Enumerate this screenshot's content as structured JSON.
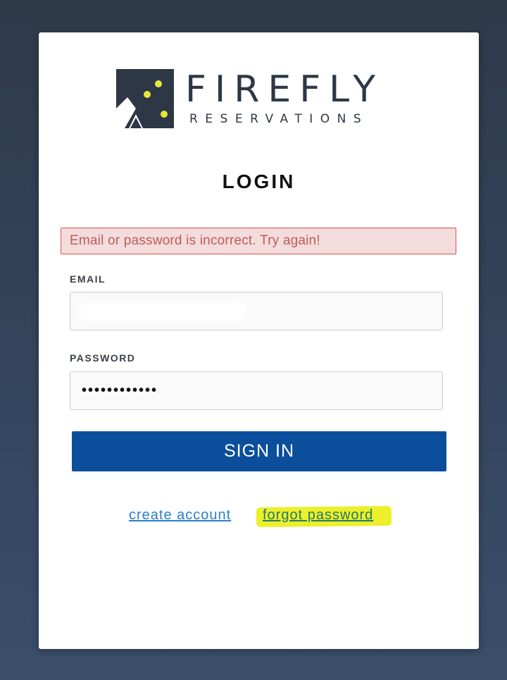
{
  "logo": {
    "wordmark": "FIREFLY",
    "subtitle": "RESERVATIONS"
  },
  "login": {
    "title": "LOGIN",
    "error_message": "Email or password is incorrect. Try again!",
    "email_label": "EMAIL",
    "email_value": "",
    "password_label": "PASSWORD",
    "password_masked": "••••••••••••",
    "sign_in_label": "SIGN IN",
    "create_account_label": "create account",
    "forgot_password_label": "forgot password"
  },
  "colors": {
    "background": "#33445c",
    "primary_button": "#0b4f9c",
    "error_bg": "#f3dcdc",
    "error_border": "#d9534f",
    "link": "#2a7fc9",
    "highlight": "#ecef2a",
    "logo": "#2e3746",
    "logo_dots": "#e6e83a"
  },
  "icons": {
    "logo_mark": "tent-with-stars-icon"
  }
}
